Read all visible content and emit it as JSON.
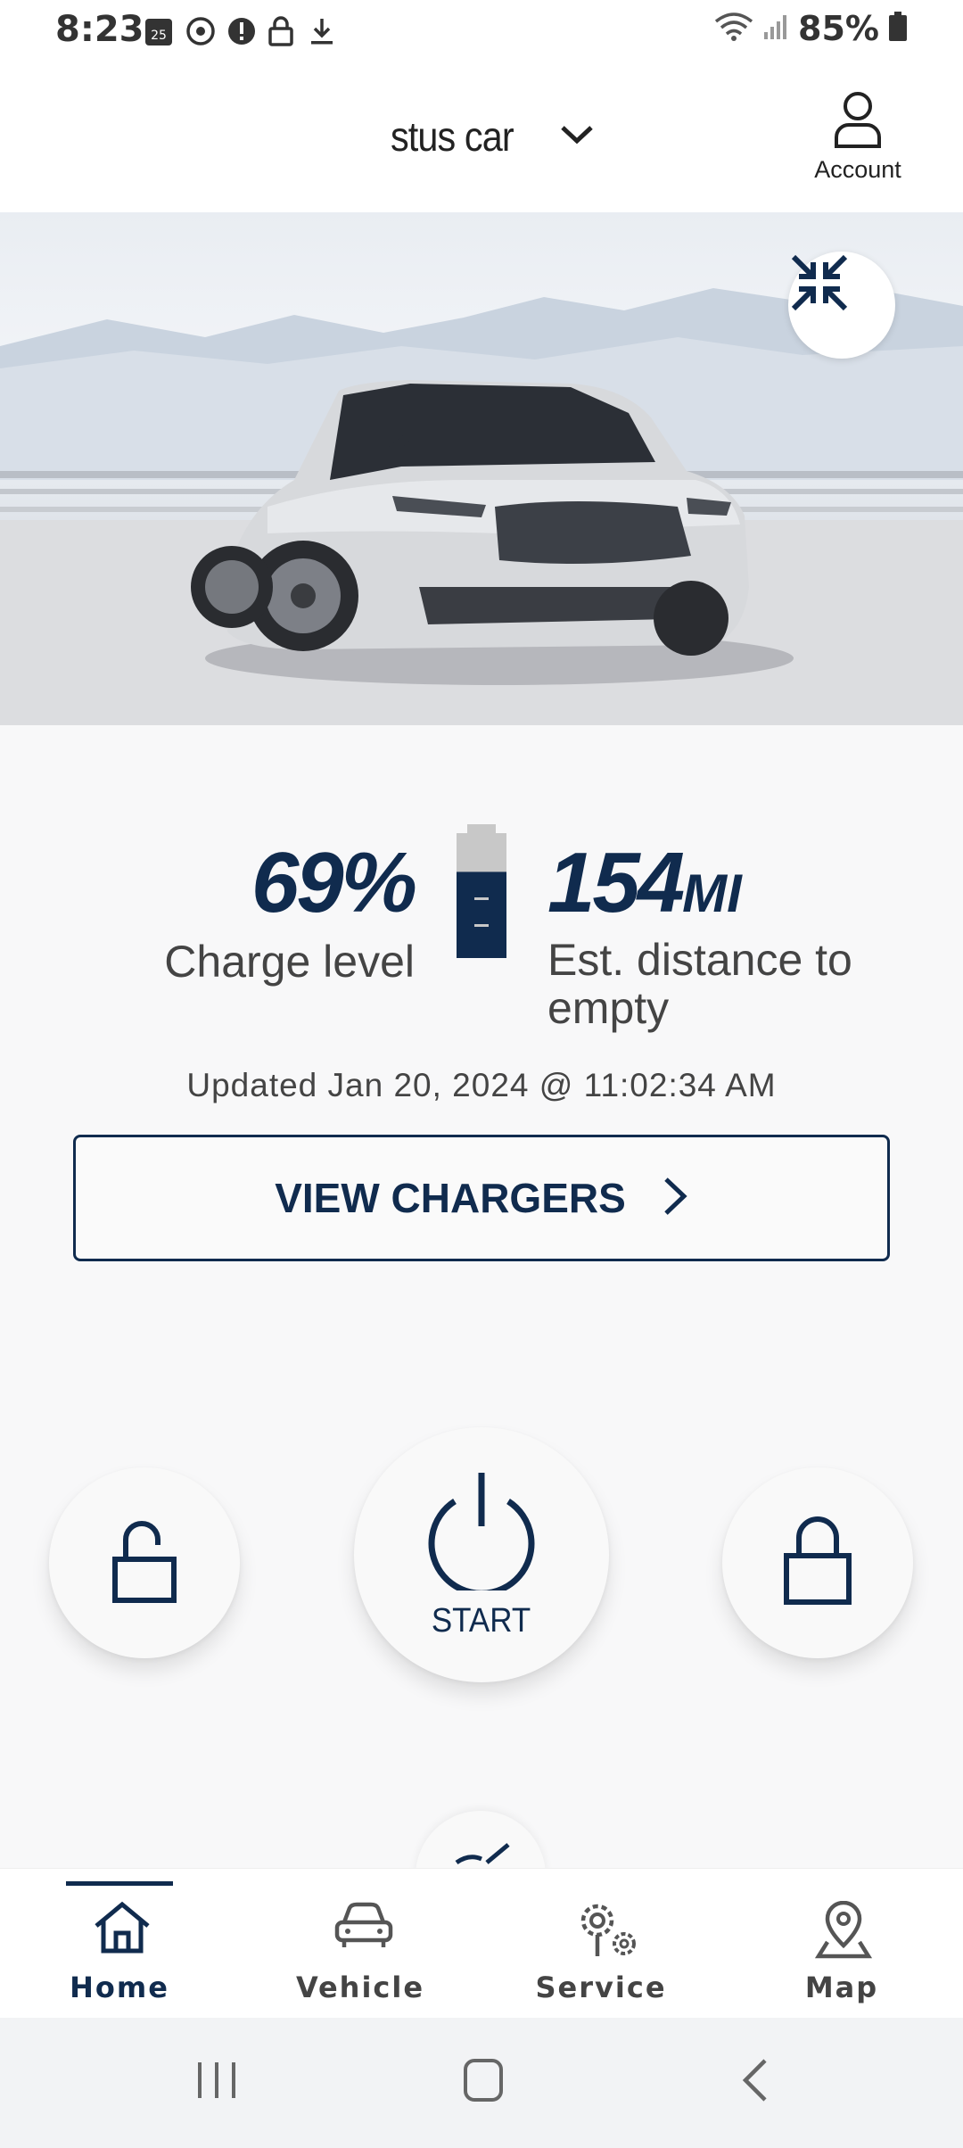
{
  "status_bar": {
    "time": "8:23",
    "calendar_day": "25",
    "battery_percent": "85%"
  },
  "header": {
    "vehicle_name": "stus car",
    "account_label": "Account"
  },
  "stats": {
    "charge_value": "69%",
    "charge_label": "Charge level",
    "battery_fill_fraction": 0.69,
    "range_value": "154",
    "range_unit": "MI",
    "range_label": "Est. distance to empty"
  },
  "updated_text": "Updated Jan 20, 2024 @ 11:02:34 AM",
  "view_chargers_label": "VIEW CHARGERS",
  "actions": {
    "start_label": "START"
  },
  "bottom_nav": {
    "items": [
      {
        "label": "Home",
        "active": true
      },
      {
        "label": "Vehicle",
        "active": false
      },
      {
        "label": "Service",
        "active": false
      },
      {
        "label": "Map",
        "active": false
      }
    ]
  },
  "colors": {
    "brand_navy": "#102b4e",
    "background": "#f8f8f9"
  }
}
